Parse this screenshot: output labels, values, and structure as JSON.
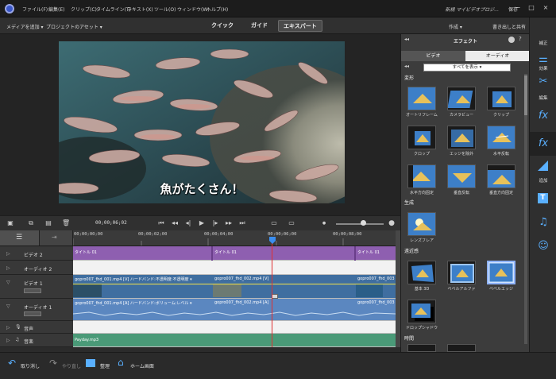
{
  "menubar": {
    "items": [
      "ファイル(F)",
      "編集(E)",
      "クリップ(C)",
      "タイムライン(T)",
      "テキスト(X)",
      "ツール(O)",
      "ウィンドウ(W)",
      "ヘルプ(H)"
    ],
    "app_title": "新規 マイビデオプロジ...",
    "save_label": "保存",
    "window_buttons": [
      "−",
      "□",
      "×"
    ]
  },
  "toolbar": {
    "add_media": "メディアを追加 ▾",
    "project_assets": "プロジェクトのアセット ▾",
    "modes": [
      "クイック",
      "ガイド",
      "エキスパート"
    ],
    "create": "作成 ▾",
    "export": "書き出しと共有"
  },
  "preview": {
    "caption": "魚がたくさん！"
  },
  "transport": {
    "timecode": "00;00;06;02"
  },
  "ruler": {
    "ticks": [
      "00;00;00;00",
      "00;00;02;00",
      "00;00;04;00",
      "00;00;06;00",
      "00;00;08;00"
    ]
  },
  "tracks": [
    {
      "name": "ビデオ 2",
      "clips": [
        "タイトル 01",
        "タイトル 01",
        "タイトル 01"
      ]
    },
    {
      "name": "オーディオ 2",
      "clips": []
    },
    {
      "name": "ビデオ 1",
      "clips": [
        "gopro007_fhd_001.mp4 [V] ハードバンド:不透明度:不透明度 ▾",
        "gopro007_fhd_002.mp4 [V]",
        "gopro007_fhd_003"
      ]
    },
    {
      "name": "オーディオ 1",
      "clips": [
        "gopro007_fhd_001.mp4 [A] ハードバンド:ボリューム:レベル ▾",
        "gopro007_fhd_002.mp4 [A]",
        "gopro007_fhd_003"
      ]
    },
    {
      "name": "音声",
      "clips": []
    },
    {
      "name": "音楽",
      "clips": [
        "Payday.mp3"
      ]
    }
  ],
  "bottombar": {
    "undo": "取り消し",
    "redo": "やり直し",
    "organize": "整理",
    "home": "ホーム画面"
  },
  "panel": {
    "title": "エフェクト",
    "tabs": [
      "ビデオ",
      "オーディオ"
    ],
    "filter": "すべてを表示 ▾",
    "sections": [
      {
        "name": "変形",
        "effects": [
          "オートリフレーム",
          "カメラビュー",
          "クリップ",
          "クロップ",
          "エッジを除外",
          "水平反転",
          "水平方向固定",
          "垂直反転",
          "垂直方向固定"
        ]
      },
      {
        "name": "生成",
        "effects": [
          "レンズフレア"
        ]
      },
      {
        "name": "遠近感",
        "effects": [
          "基本 3D",
          "ベベルアルファ",
          "ベベルエッジ",
          "ドロップシャドウ"
        ]
      },
      {
        "name": "時間",
        "effects": []
      }
    ]
  },
  "rail": {
    "items": [
      "補正",
      "効果",
      "編集",
      "fx",
      "fx",
      "追加",
      "T",
      "♫",
      "☺"
    ]
  },
  "colors": {
    "accent": "#5ab0ff",
    "title_track": "#8e5fb0",
    "video_clip": "#3f6ea0",
    "audio_clip": "#5b87c0",
    "music_clip": "#4a9a78",
    "playhead": "#e03030"
  }
}
